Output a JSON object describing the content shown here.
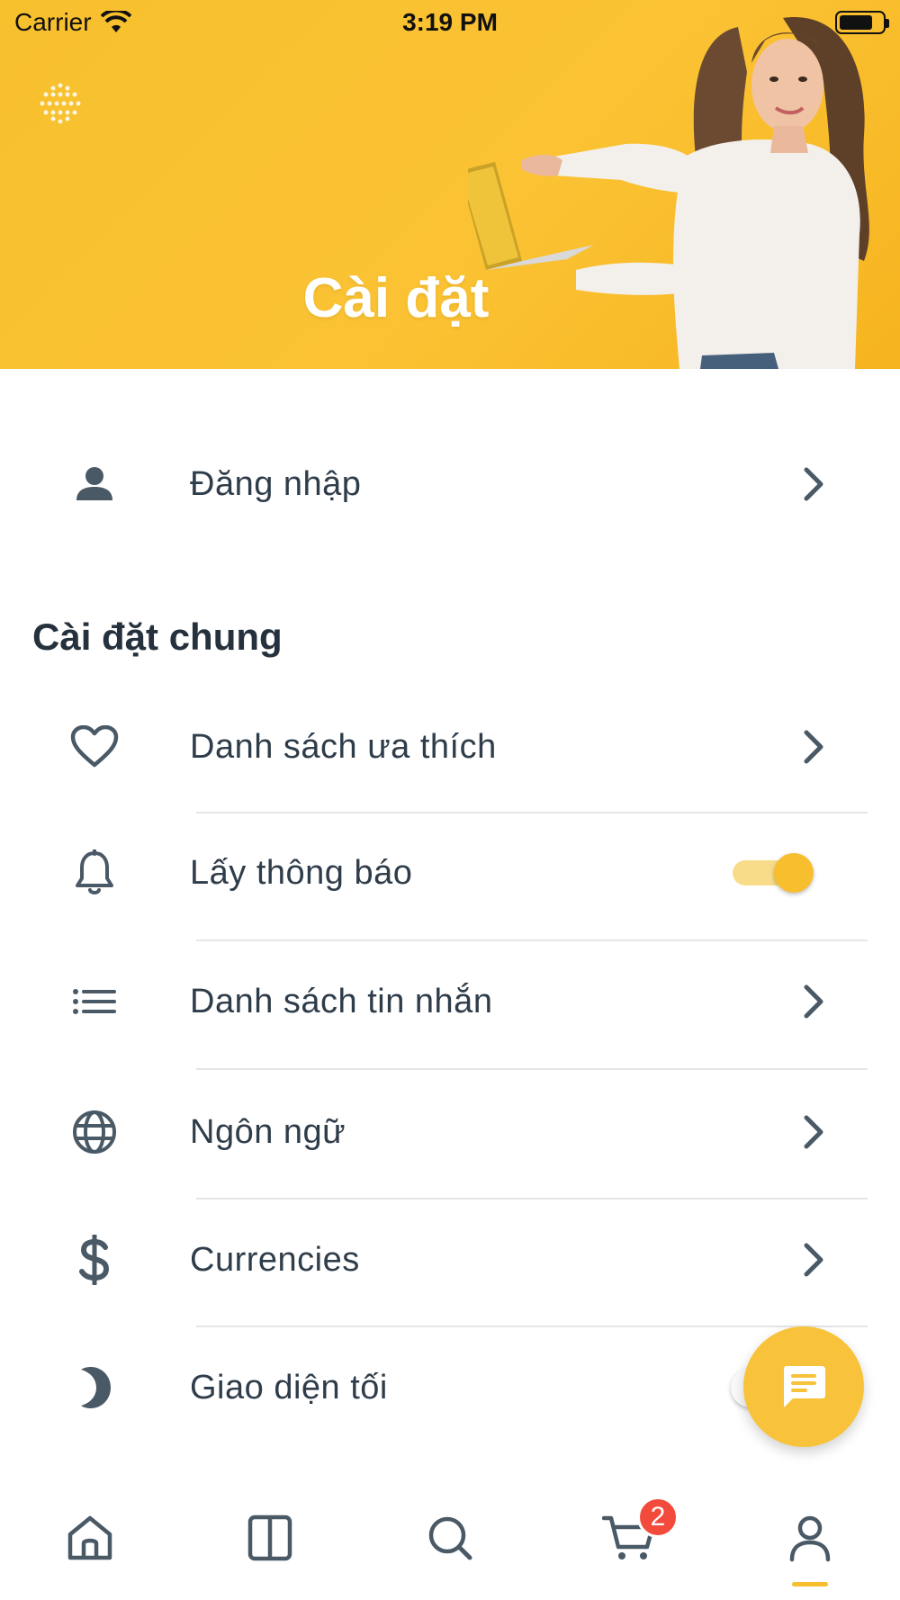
{
  "status_bar": {
    "carrier": "Carrier",
    "time": "3:19 PM"
  },
  "header": {
    "title": "Cài đặt"
  },
  "login": {
    "label": "Đăng nhập"
  },
  "general_section": {
    "title": "Cài đặt chung",
    "items": [
      {
        "label": "Danh sách ưa thích",
        "icon": "heart-icon",
        "control": "chevron"
      },
      {
        "label": "Lấy thông báo",
        "icon": "bell-icon",
        "control": "toggle",
        "toggle_on": true
      },
      {
        "label": "Danh sách tin nhắn",
        "icon": "list-icon",
        "control": "chevron"
      },
      {
        "label": "Ngôn ngữ",
        "icon": "globe-icon",
        "control": "chevron"
      },
      {
        "label": "Currencies",
        "icon": "dollar-icon",
        "control": "chevron"
      },
      {
        "label": "Giao diện tối",
        "icon": "moon-icon",
        "control": "toggle",
        "toggle_on": false
      }
    ]
  },
  "bottom_nav": {
    "items": [
      "home-icon",
      "columns-icon",
      "search-icon",
      "cart-icon",
      "user-icon"
    ],
    "active": "user-icon",
    "cart_badge": "2"
  },
  "colors": {
    "accent": "#f7bf2e",
    "text": "#2f3d4a",
    "icon": "#4a5966",
    "badge": "#f24b3c"
  }
}
